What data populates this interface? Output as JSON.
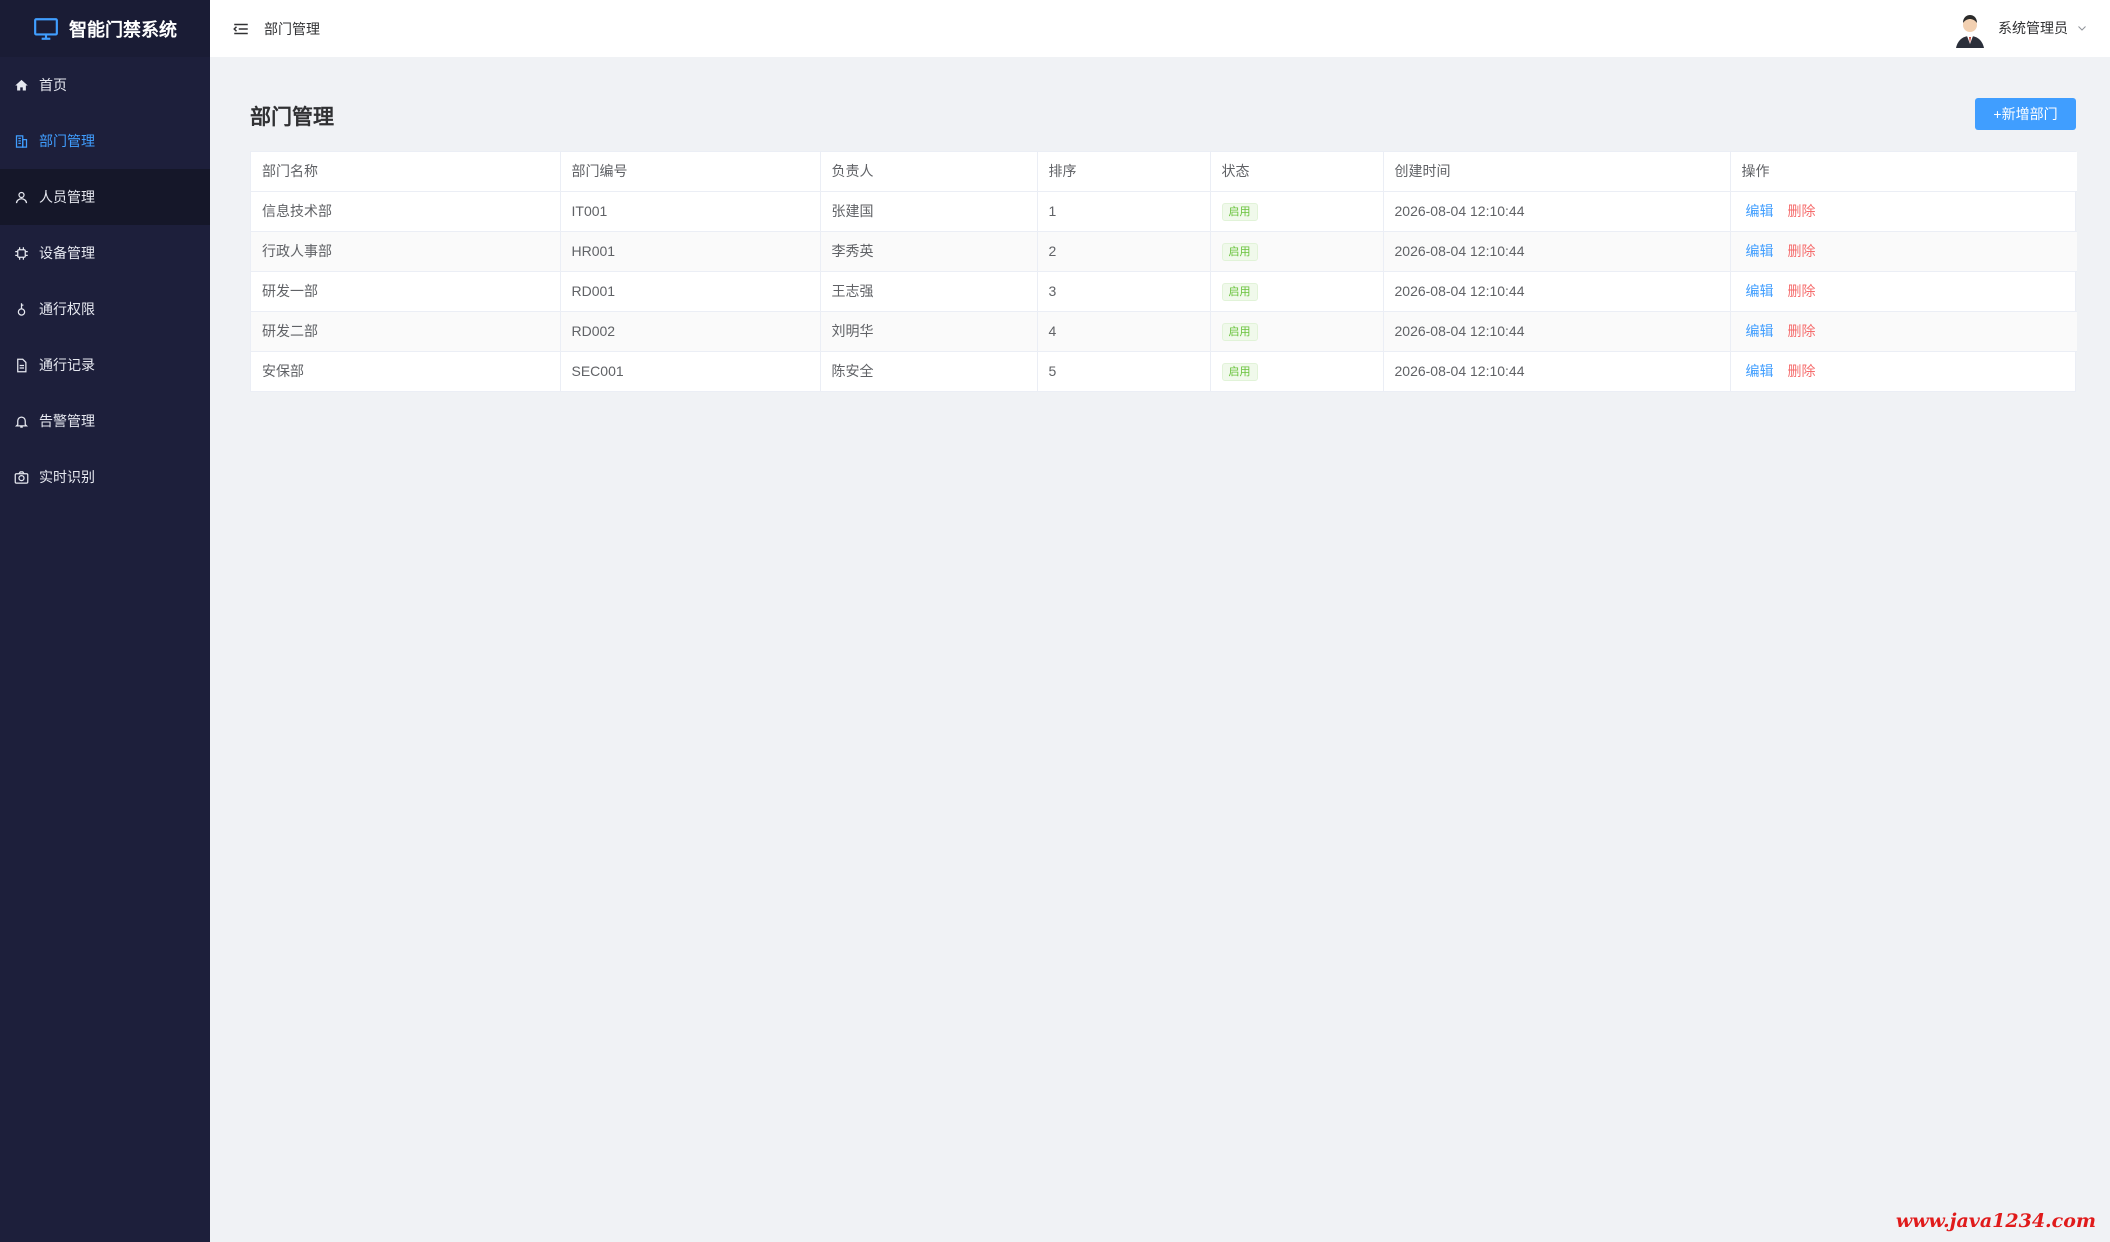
{
  "app": {
    "title": "智能门禁系统"
  },
  "sidebar": {
    "items": [
      {
        "label": "首页",
        "icon": "home-icon"
      },
      {
        "label": "部门管理",
        "icon": "building-icon"
      },
      {
        "label": "人员管理",
        "icon": "user-icon"
      },
      {
        "label": "设备管理",
        "icon": "cpu-icon"
      },
      {
        "label": "通行权限",
        "icon": "key-icon"
      },
      {
        "label": "通行记录",
        "icon": "document-icon"
      },
      {
        "label": "告警管理",
        "icon": "bell-icon"
      },
      {
        "label": "实时识别",
        "icon": "camera-icon"
      }
    ],
    "active_index": 1
  },
  "header": {
    "breadcrumb": "部门管理",
    "user_name": "系统管理员"
  },
  "main": {
    "title": "部门管理",
    "add_button": "+新增部门",
    "table": {
      "columns": [
        "部门名称",
        "部门编号",
        "负责人",
        "排序",
        "状态",
        "创建时间",
        "操作"
      ],
      "rows": [
        {
          "name": "信息技术部",
          "code": "IT001",
          "manager": "张建国",
          "order": "1",
          "status": "启用",
          "created": "2026-08-04 12:10:44"
        },
        {
          "name": "行政人事部",
          "code": "HR001",
          "manager": "李秀英",
          "order": "2",
          "status": "启用",
          "created": "2026-08-04 12:10:44"
        },
        {
          "name": "研发一部",
          "code": "RD001",
          "manager": "王志强",
          "order": "3",
          "status": "启用",
          "created": "2026-08-04 12:10:44"
        },
        {
          "name": "研发二部",
          "code": "RD002",
          "manager": "刘明华",
          "order": "4",
          "status": "启用",
          "created": "2026-08-04 12:10:44"
        },
        {
          "name": "安保部",
          "code": "SEC001",
          "manager": "陈安全",
          "order": "5",
          "status": "启用",
          "created": "2026-08-04 12:10:44"
        }
      ],
      "actions": {
        "edit": "编辑",
        "delete": "删除"
      }
    }
  },
  "watermark": "www.java1234.com",
  "colors": {
    "sidebar_bg": "#1d1f3b",
    "accent": "#409eff",
    "danger": "#f56c6c",
    "success": "#67c23a"
  }
}
